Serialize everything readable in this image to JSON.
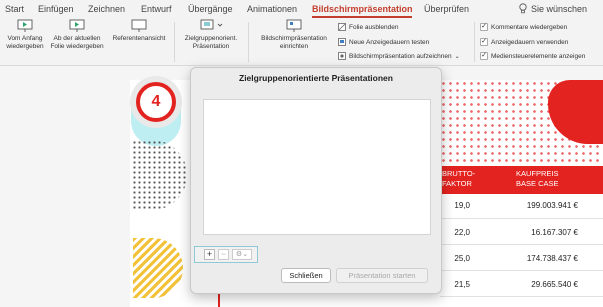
{
  "tabs": {
    "items": [
      "Start",
      "Einfügen",
      "Zeichnen",
      "Entwurf",
      "Übergänge",
      "Animationen",
      "Bildschirmpräsentation",
      "Überprüfen"
    ],
    "active": "Bildschirmpräsentation",
    "help": "Sie wünschen"
  },
  "ribbon": {
    "from_start": "Vom Anfang\nwiedergeben",
    "from_current": "Ab der aktuellen\nFolie wiedergeben",
    "presenter_view": "Referentenansicht",
    "custom_show": "Zielgruppenorient.\nPräsentation",
    "setup_show": "Bildschirmpräsentation\neinrichten",
    "hide_slide": "Folie ausblenden",
    "rehearse_timings": "Neue Anzeigedauern testen",
    "record_show": "Bildschirmpräsentation aufzeichnen",
    "play_narrations": "Kommentare wiedergeben",
    "use_timings": "Anzeigedauern verwenden",
    "show_media_controls": "Mediensteuerelemente anzeigen"
  },
  "slide": {
    "badge_number": "4",
    "table": {
      "headers": [
        "BRUTTO-\nFAKTOR",
        "KAUFPREIS\nBASE CASE"
      ],
      "rows": [
        [
          "19,0",
          "199.003.941 €"
        ],
        [
          "22,0",
          "16.167.307 €"
        ],
        [
          "25,0",
          "174.738.437 €"
        ],
        [
          "21,5",
          "29.665.540 €"
        ]
      ]
    }
  },
  "dialog": {
    "title": "Zielgruppenorientierte Präsentationen",
    "add_symbol": "+",
    "remove_symbol": "−",
    "options_symbol": "⚙︎⌄",
    "close_label": "Schließen",
    "start_label": "Präsentation starten"
  },
  "colors": {
    "accent": "#c43e2e",
    "slide_red": "#e3231f",
    "teal_focus": "#8ecad3"
  }
}
